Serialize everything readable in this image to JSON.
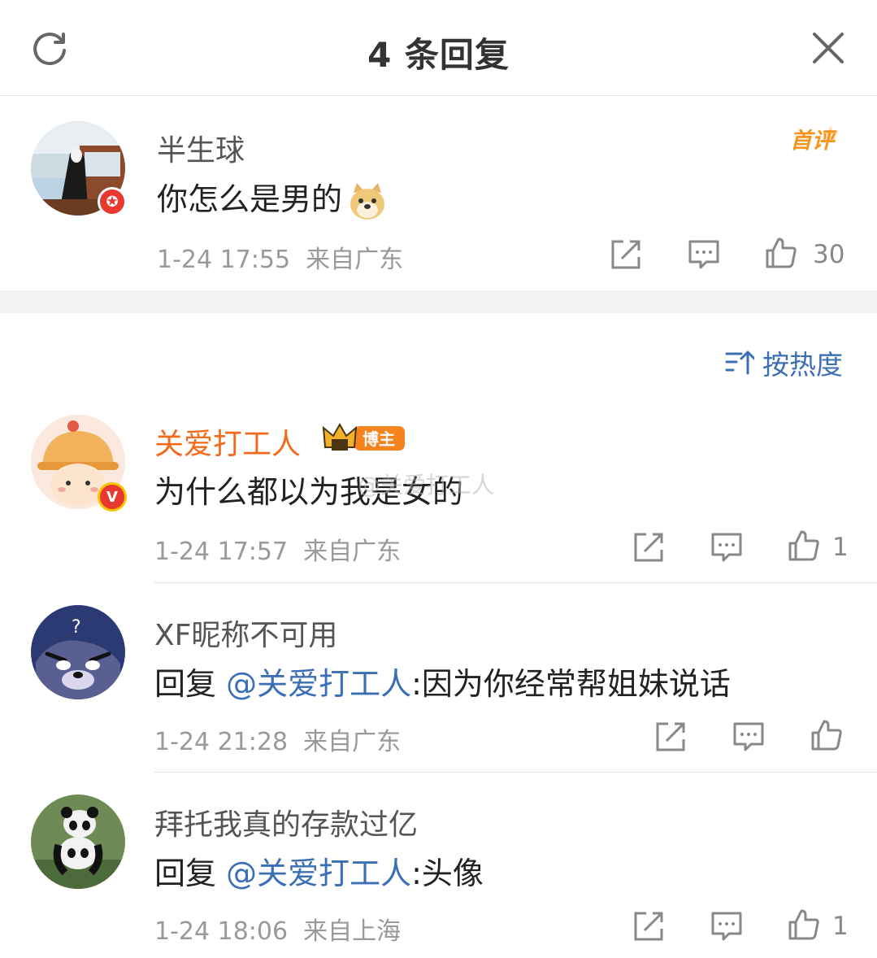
{
  "header": {
    "title": "4 条回复"
  },
  "main_comment": {
    "username": "半生球",
    "text": "你怎么是男的",
    "first_badge": "首评",
    "time": "1-24 17:55",
    "location": "来自广东",
    "likes": "30"
  },
  "sort": {
    "label": "按热度"
  },
  "replies": [
    {
      "username": "关爱打工人",
      "author_tag": "博主",
      "text": "为什么都以为我是女的",
      "time": "1-24 17:57",
      "location": "来自广东",
      "likes": "1"
    },
    {
      "username": "XF昵称不可用",
      "prefix": "回复",
      "mention": "@关爱打工人",
      "text": ":因为你经常帮姐妹说话",
      "time": "1-24 21:28",
      "location": "来自广东",
      "likes": ""
    },
    {
      "username": "拜托我真的存款过亿",
      "prefix": "回复",
      "mention": "@关爱打工人",
      "text": ":头像",
      "time": "1-24 18:06",
      "location": "来自上海",
      "likes": "1"
    }
  ],
  "watermark": "@关爱打工人",
  "colors": {
    "accent_blue": "#3b6fb5",
    "orange": "#f26b1d",
    "badge_red": "#e8382f",
    "text_gray": "#999999"
  }
}
